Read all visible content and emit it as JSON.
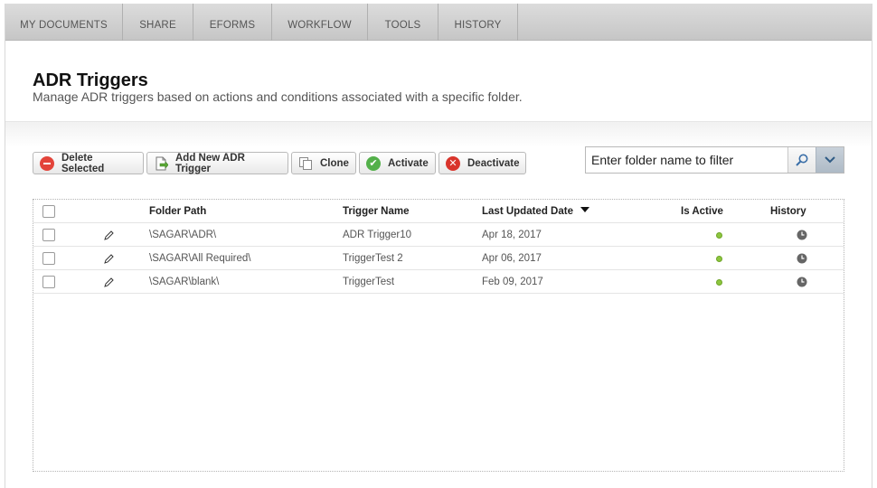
{
  "nav": {
    "items": [
      {
        "label": "MY DOCUMENTS"
      },
      {
        "label": "SHARE"
      },
      {
        "label": "EFORMS"
      },
      {
        "label": "WORKFLOW"
      },
      {
        "label": "TOOLS"
      },
      {
        "label": "HISTORY"
      }
    ]
  },
  "header": {
    "title": "ADR Triggers",
    "subtitle": "Manage ADR triggers based on actions and conditions associated with a specific folder."
  },
  "toolbar": {
    "delete_label": "Delete Selected",
    "add_label": "Add New ADR Trigger",
    "clone_label": "Clone",
    "activate_label": "Activate",
    "deactivate_label": "Deactivate"
  },
  "search": {
    "placeholder": "Enter folder name to filter",
    "value": ""
  },
  "table": {
    "columns": {
      "folder_path": "Folder Path",
      "trigger_name": "Trigger Name",
      "last_updated": "Last Updated Date",
      "is_active": "Is Active",
      "history": "History"
    },
    "sort": {
      "column": "Last Updated Date",
      "direction": "descending"
    },
    "rows": [
      {
        "folder_path": "\\SAGAR\\ADR\\",
        "trigger_name": "ADR Trigger10",
        "last_updated": "Apr 18, 2017",
        "is_active": true
      },
      {
        "folder_path": "\\SAGAR\\All Required\\",
        "trigger_name": "TriggerTest 2",
        "last_updated": "Apr 06, 2017",
        "is_active": true
      },
      {
        "folder_path": "\\SAGAR\\blank\\",
        "trigger_name": "TriggerTest",
        "last_updated": "Feb 09, 2017",
        "is_active": true
      }
    ]
  },
  "colors": {
    "active_dot": "#8dc63f",
    "delete_icon": "#e3443a",
    "activate_icon": "#53b04a",
    "deactivate_icon": "#d9342b"
  }
}
